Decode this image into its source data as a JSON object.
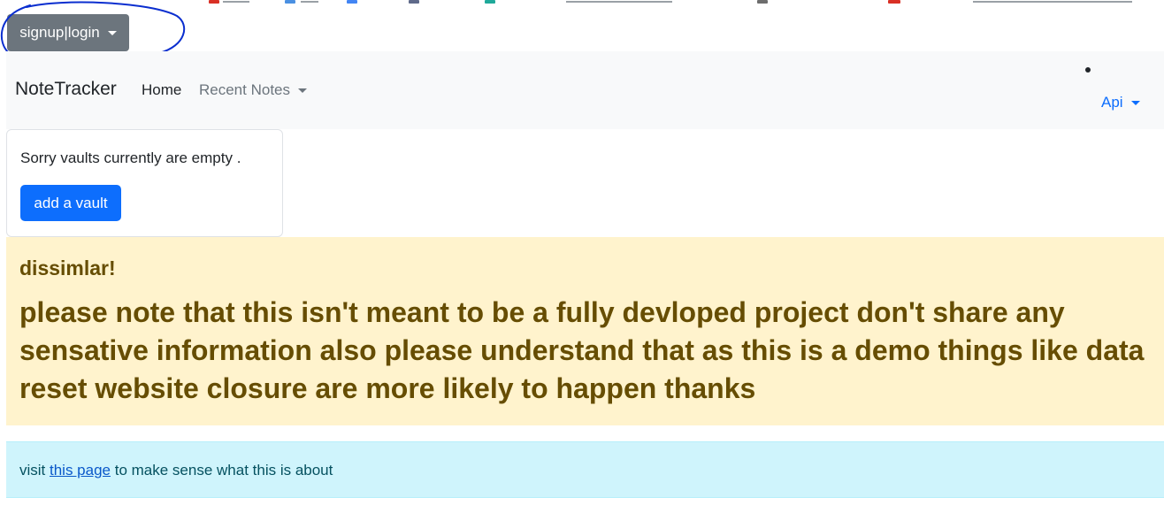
{
  "auth": {
    "label": "signup|login"
  },
  "navbar": {
    "brand": "NoteTracker",
    "items": [
      {
        "label": "Home"
      },
      {
        "label": "Recent Notes"
      }
    ],
    "api_label": "Api"
  },
  "vault_card": {
    "message": "Sorry vaults currently are empty .",
    "button_label": "add a vault"
  },
  "disclaimer": {
    "heading": "dissimlar!",
    "body": "please note that this isn't meant to be a fully devloped project don't share any sensative information also please understand that as this is a demo things like data reset website closure are more likely to happen thanks"
  },
  "info": {
    "prefix": "visit ",
    "link_text": "this page",
    "suffix": " to make sense what this is about"
  },
  "colors": {
    "auth_button_bg": "#6c757d",
    "primary": "#0d6efd",
    "navbar_bg": "#f8f9fa",
    "warning_bg": "#fff3cd",
    "warning_text": "#664d03",
    "info_bg": "#cff4fc",
    "annotation": "#0a2ecf"
  },
  "icons": {
    "dropdown": "caret-down-icon",
    "annotation": "hand-drawn-circle"
  }
}
